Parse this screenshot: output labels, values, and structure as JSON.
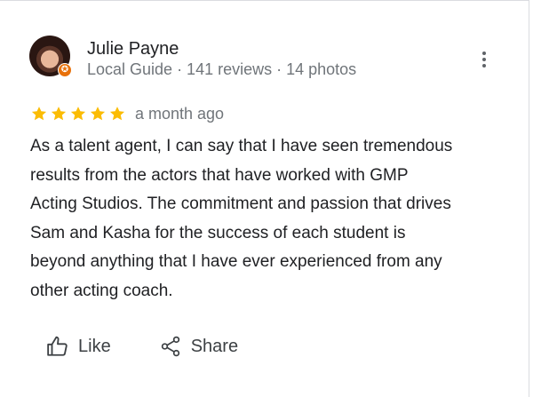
{
  "review": {
    "author": {
      "name": "Julie Payne",
      "meta": "Local Guide · 141 reviews · 14 photos",
      "badge_symbol": "✪"
    },
    "rating": 5,
    "rating_max": 5,
    "date": "a month ago",
    "text": "As a talent agent, I can say that I have seen tremendous\nresults from the actors that have worked with  GMP\nActing Studios. The commitment and passion that drives\nSam and Kasha for the success of each student is\nbeyond anything that I have ever experienced from any\nother acting coach.",
    "actions": {
      "like_label": "Like",
      "share_label": "Share"
    }
  },
  "colors": {
    "star": "#fbbc04",
    "badge": "#e8710a",
    "secondary_text": "#70757a",
    "primary_text": "#202124"
  },
  "icons": {
    "more": "more-vert-icon",
    "like": "thumb-up-icon",
    "share": "share-icon",
    "badge": "local-guide-badge-icon"
  }
}
